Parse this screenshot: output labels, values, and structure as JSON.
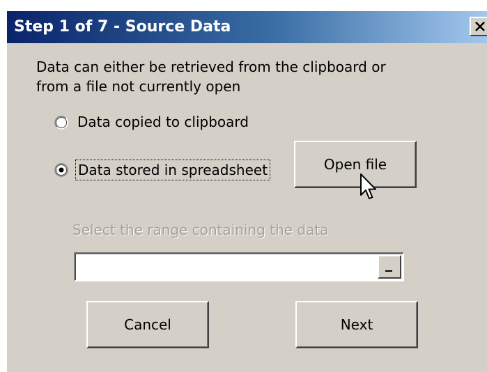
{
  "dialog": {
    "title": "Step 1 of 7 - Source Data",
    "close_label": "X",
    "intro_line1": "Data can either be retrieved from the clipboard or",
    "intro_line2": "from a file not currently open"
  },
  "options": {
    "clipboard_label": "Data copied to clipboard",
    "clipboard_selected": false,
    "spreadsheet_label": "Data stored in spreadsheet",
    "spreadsheet_selected": true
  },
  "buttons": {
    "open_file_label": "Open file",
    "cancel_label": "Cancel",
    "next_label": "Next"
  },
  "range": {
    "label": "Select the range containing the data",
    "value": "",
    "picker_label": "_"
  },
  "colors": {
    "title_start": "#0a246a",
    "title_end": "#a6caf0",
    "dialog_face": "#d4d0c8",
    "disabled_text": "#a4a19b"
  }
}
